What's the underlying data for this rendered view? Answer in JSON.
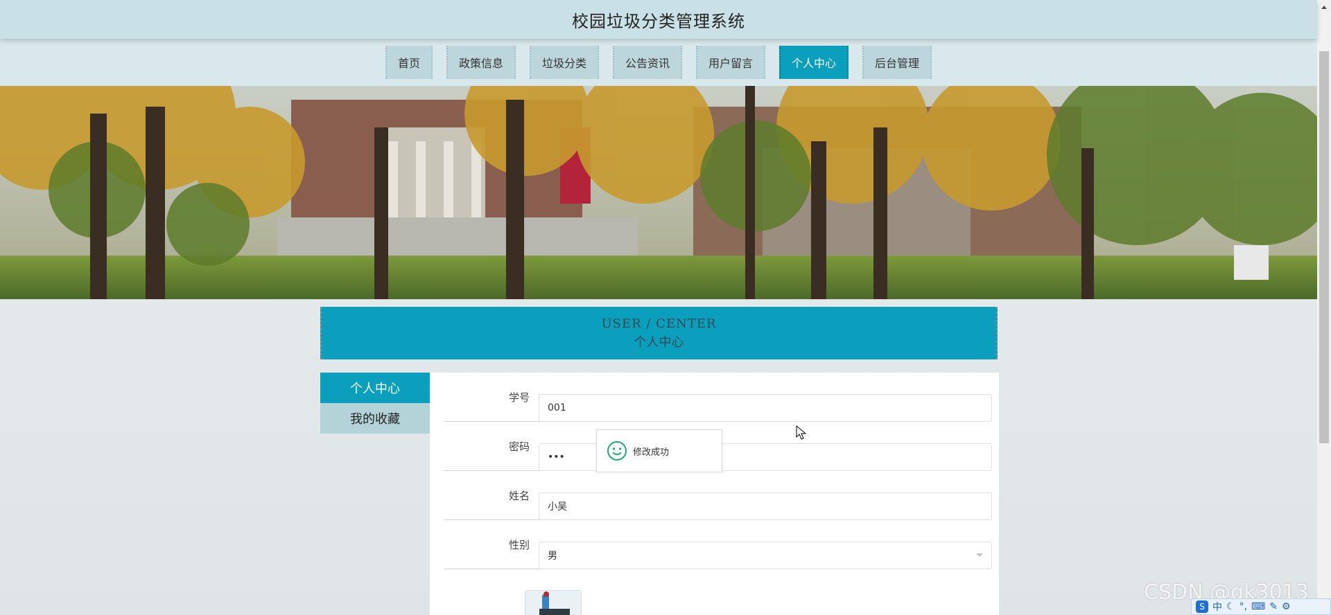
{
  "header": {
    "title": "校园垃圾分类管理系统"
  },
  "nav": {
    "items": [
      {
        "label": "首页"
      },
      {
        "label": "政策信息"
      },
      {
        "label": "垃圾分类"
      },
      {
        "label": "公告资讯"
      },
      {
        "label": "用户留言"
      },
      {
        "label": "个人中心",
        "active": true
      },
      {
        "label": "后台管理"
      }
    ]
  },
  "section": {
    "title_en": "USER / CENTER",
    "title_cn": "个人中心"
  },
  "side_menu": {
    "items": [
      {
        "label": "个人中心",
        "active": true
      },
      {
        "label": "我的收藏"
      }
    ]
  },
  "form": {
    "fields": [
      {
        "label": "学号",
        "value": "001"
      },
      {
        "label": "密码",
        "value": "•••"
      },
      {
        "label": "姓名",
        "value": "小吴"
      },
      {
        "label": "性别",
        "value": "男"
      }
    ]
  },
  "toast": {
    "message": "修改成功",
    "icon": "smile-icon"
  },
  "watermark": {
    "text": "CSDN @qk3013"
  },
  "ime": {
    "mode": "中"
  },
  "colors": {
    "accent": "#0aa0bd",
    "header_bg": "#c9e1e6",
    "nav_bg": "#bcd6dc"
  }
}
